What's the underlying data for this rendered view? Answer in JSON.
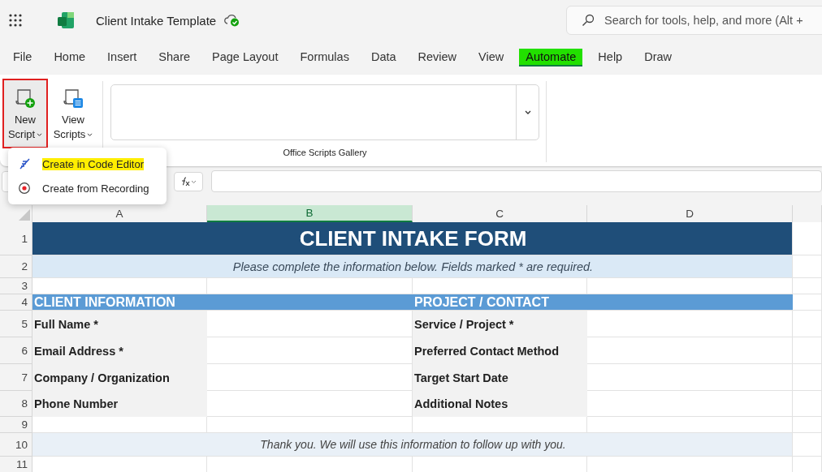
{
  "app": {
    "title": "Client Intake Template",
    "saved": true
  },
  "search": {
    "placeholder": "Search for tools, help, and more (Alt +"
  },
  "tabs": [
    {
      "label": "File",
      "selected": false,
      "highlighted": false
    },
    {
      "label": "Home",
      "selected": false,
      "highlighted": false
    },
    {
      "label": "Insert",
      "selected": false,
      "highlighted": false
    },
    {
      "label": "Share",
      "selected": false,
      "highlighted": false
    },
    {
      "label": "Page Layout",
      "selected": false,
      "highlighted": false
    },
    {
      "label": "Formulas",
      "selected": false,
      "highlighted": false
    },
    {
      "label": "Data",
      "selected": false,
      "highlighted": false
    },
    {
      "label": "Review",
      "selected": false,
      "highlighted": false
    },
    {
      "label": "View",
      "selected": false,
      "highlighted": false
    },
    {
      "label": "Automate",
      "selected": true,
      "highlighted": true
    },
    {
      "label": "Help",
      "selected": false,
      "highlighted": false
    },
    {
      "label": "Draw",
      "selected": false,
      "highlighted": false
    }
  ],
  "ribbon": {
    "buttons": [
      {
        "kind": "new",
        "line1": "New",
        "line2": "Script",
        "highlighted": true
      },
      {
        "kind": "view",
        "line1": "View",
        "line2": "Scripts",
        "highlighted": false
      }
    ],
    "gallery": {
      "label": "Office Scripts Gallery"
    }
  },
  "menu": [
    {
      "kind": "editor",
      "label": "Create in Code Editor",
      "highlighted": true
    },
    {
      "kind": "record",
      "label": "Create from Recording",
      "highlighted": false
    }
  ],
  "columns": [
    {
      "label": "A",
      "selected": false
    },
    {
      "label": "B",
      "selected": true
    },
    {
      "label": "C",
      "selected": false
    },
    {
      "label": "D",
      "selected": false
    }
  ],
  "rows": [
    {
      "number": "1",
      "kind": "title",
      "text": "CLIENT INTAKE FORM"
    },
    {
      "number": "2",
      "kind": "note",
      "text": "Please complete the information below. Fields marked * are required."
    },
    {
      "number": "3",
      "kind": "blank"
    },
    {
      "number": "4",
      "kind": "section",
      "left": "CLIENT INFORMATION",
      "right": "PROJECT / CONTACT"
    },
    {
      "number": "5",
      "kind": "field",
      "left": "Full Name *",
      "right": "Service / Project *"
    },
    {
      "number": "6",
      "kind": "field",
      "left": "Email Address *",
      "right": "Preferred Contact Method"
    },
    {
      "number": "7",
      "kind": "field",
      "left": "Company / Organization",
      "right": "Target Start Date"
    },
    {
      "number": "8",
      "kind": "field",
      "left": "Phone Number",
      "right": "Additional Notes"
    },
    {
      "number": "9",
      "kind": "blank"
    },
    {
      "number": "10",
      "kind": "footer",
      "text": "Thank you. We will use this information to follow up with you."
    },
    {
      "number": "11",
      "kind": "blank"
    }
  ]
}
